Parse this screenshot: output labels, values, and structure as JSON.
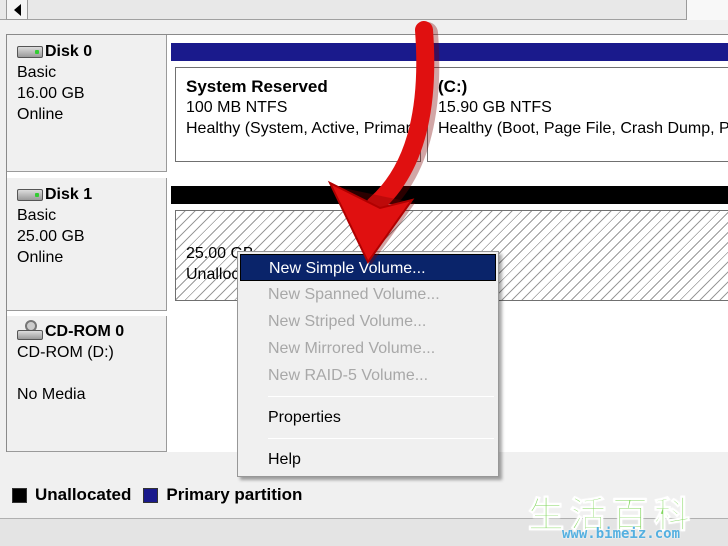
{
  "disks": [
    {
      "name": "Disk 0",
      "icon": "hard-disk-icon",
      "type": "Basic",
      "size": "16.00 GB",
      "status": "Online",
      "volumes": [
        {
          "title": "System Reserved",
          "size_fs": "100 MB NTFS",
          "health": "Healthy (System, Active, Primary Partition)"
        },
        {
          "title": "(C:)",
          "size_fs": "15.90 GB NTFS",
          "health": "Healthy (Boot, Page File, Crash Dump, Primary Partition)"
        }
      ]
    },
    {
      "name": "Disk 1",
      "icon": "hard-disk-icon",
      "type": "Basic",
      "size": "25.00 GB",
      "status": "Online",
      "volumes": [
        {
          "size": "25.00 GB",
          "label": "Unallocated"
        }
      ]
    },
    {
      "name": "CD-ROM 0",
      "icon": "cd-rom-icon",
      "type": "CD-ROM (D:)",
      "status": "No Media"
    }
  ],
  "context_menu": {
    "items": [
      {
        "label": "New Simple Volume...",
        "enabled": true,
        "highlighted": true
      },
      {
        "label": "New Spanned Volume...",
        "enabled": false
      },
      {
        "label": "New Striped Volume...",
        "enabled": false
      },
      {
        "label": "New Mirrored Volume...",
        "enabled": false
      },
      {
        "label": "New RAID-5 Volume...",
        "enabled": false
      },
      {
        "label": "Properties",
        "enabled": true
      },
      {
        "label": "Help",
        "enabled": true
      }
    ]
  },
  "legend": [
    {
      "label": "Unallocated",
      "color": "#000000"
    },
    {
      "label": "Primary partition",
      "color": "#1a1a8c"
    }
  ],
  "colors": {
    "primary_bar": "#1a1a8c",
    "unallocated_bar": "#000000",
    "menu_highlight": "#0a246a",
    "arrow": "#e01010"
  },
  "watermark": {
    "chars": "生活百科",
    "url": "www.bimeiz.com"
  }
}
